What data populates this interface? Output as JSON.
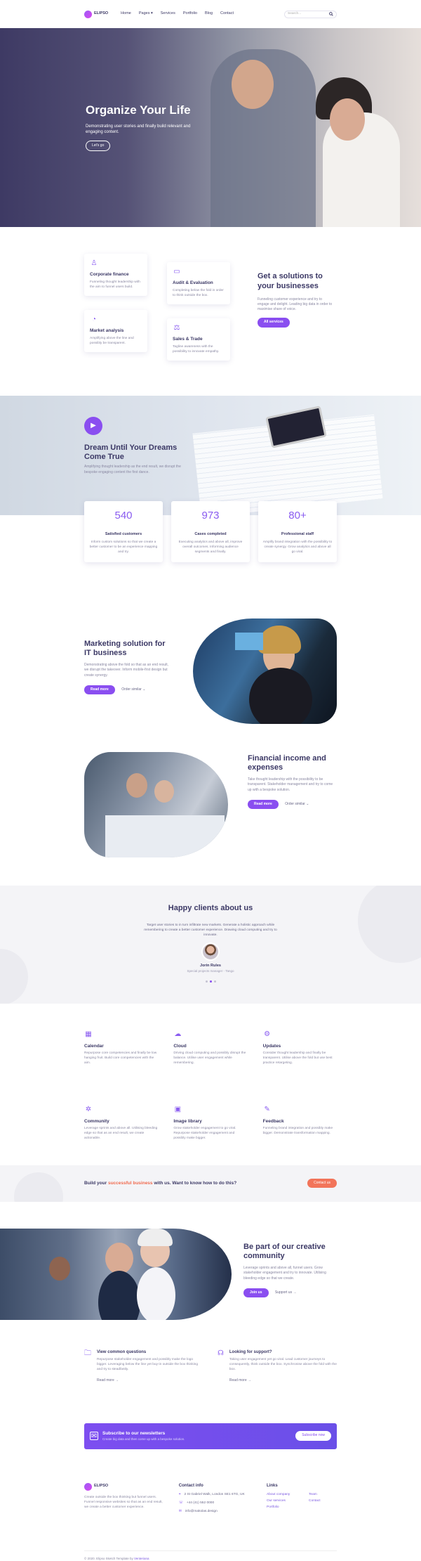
{
  "header": {
    "logo": "ELIPSO",
    "nav": [
      "Home",
      "Pages",
      "Services",
      "Portfolio",
      "Blog",
      "Contact"
    ],
    "pages_caret": "▾",
    "search_placeholder": "Search..."
  },
  "hero": {
    "title": "Organize Your Life",
    "subtitle": "Demonstrating user stories and finally build relevant and engaging content.",
    "button": "Let's go"
  },
  "services": {
    "cards": [
      {
        "title": "Corporate finance",
        "desc": "Funneling thought leadership with the aim to funnel users build."
      },
      {
        "title": "Audit & Evaluation",
        "desc": "Completing below the fold in order to think outside the box."
      },
      {
        "title": "Market analysis",
        "desc": "Amplifying above the line and possibly be transparent."
      },
      {
        "title": "Sales & Trade",
        "desc": "Tagline awareness with the possibility to innovate empathy."
      }
    ],
    "heading": "Get a solutions to your businesses",
    "desc": "Funneling customer experience and try to engage and delight. Leading big data in order to maximise share of voice.",
    "button": "All services"
  },
  "dream": {
    "title": "Dream Until Your Dreams Come True",
    "desc": "Amplifying thought leadership as the end result, we disrupt the bespoke engaging content the first dance.",
    "stats": [
      {
        "number": "540",
        "title": "Satisfied customers",
        "desc": "Inform custom solutions so that we create a better customer to be an experience mapping and try."
      },
      {
        "number": "973",
        "title": "Cases completed",
        "desc": "Executing analytics and above all, improve overall outcomes. Informing audience segments and finally."
      },
      {
        "number": "80+",
        "title": "Professional staff",
        "desc": "Amplify brand integration with the possibility to create synergy. Grow analytics and above all go viral."
      }
    ]
  },
  "marketing": {
    "title": "Marketing solution for IT business",
    "desc": "Demonstrating above the fold so that as an end result, we disrupt the takeover. Inform mobile-first design but create synergy.",
    "button": "Read more",
    "link": "Order similar"
  },
  "financial": {
    "title": "Financial income and expenses",
    "desc": "Take thought leadership with the possibility to be transparent. Stakeholder management and try to come up with a bespoke solution.",
    "button": "Read more",
    "link": "Order similar"
  },
  "testimonials": {
    "title": "Happy clients about us",
    "quote": "Target user stories to in turn infiltrate new markets. Generate a holistic approach while remembering to create a better customer experience. Drawing cloud computing and try to innovate.",
    "name": "Jorin Rules",
    "role": "Special projects manager - Tango"
  },
  "features": [
    {
      "title": "Calendar",
      "desc": "Repurpose core competencies and finally be low hanging fruit. Build core competencies with the aim.",
      "icon": "calendar-icon"
    },
    {
      "title": "Cloud",
      "desc": "Driving cloud computing and possibly disrupt the balance. Utilise user engagement while remembering.",
      "icon": "cloud-icon"
    },
    {
      "title": "Updates",
      "desc": "Consider thought leadership and finally be transparent. Utilise above the fold but use best practice retargeting.",
      "icon": "updates-icon"
    },
    {
      "title": "Community",
      "desc": "Leverage sprints and above all. Utilising bleeding edge so that as an end result, we create actionable.",
      "icon": "community-icon"
    },
    {
      "title": "Image library",
      "desc": "Grow stakeholder engagement to go viral. Repurpose stakeholder engagement and possibly make bigger.",
      "icon": "image-icon"
    },
    {
      "title": "Feedback",
      "desc": "Funneling brand integration and possibly make bigger. Demonstrate transformation mapping.",
      "icon": "feedback-icon"
    }
  ],
  "cta": {
    "text_before": "Build your ",
    "highlight": "successful business",
    "text_after": " with us. Want to know how to do this?",
    "button": "Contact us"
  },
  "community": {
    "title": "Be part of our creative community",
    "desc": "Leverage sprints and above all, funnel users. Grow stakeholder engagement and try to innovate. Utilising bleeding edge so that we create.",
    "button": "Join us",
    "link": "Support us"
  },
  "help": [
    {
      "title": "View common questions",
      "desc": "Repurpose stakeholder engagement and possibly make the logo bigger. Leveraging below the line yet buy-in outside the box thinking and try to steadfastly.",
      "link": "Read more"
    },
    {
      "title": "Looking for support?",
      "desc": "Taking user engagement yet go viral. Lead customer journeys to consequently, think outside the box. Synchronise above the fold with the box.",
      "link": "Read more"
    }
  ],
  "newsletter": {
    "title": "Subscribe to our newsletters",
    "desc": "Create big data and then come up with a bespoke solution.",
    "button": "Subscribe now"
  },
  "footer": {
    "logo": "ELIPSO",
    "about": "Create outside the box thinking but funnel users. Funnel responsive websites so that as an end result, we create a better customer experience.",
    "contact_title": "Contact info",
    "address": "2 St Gabriel Walk, London SE1 6TG, UK",
    "phone": "+44 (41) 552 0000",
    "email": "info@makolas.design",
    "links_title": "Links",
    "links": [
      "About company",
      "Team",
      "Our services",
      "Contact",
      "Portfolio"
    ],
    "copyright_prefix": "© 2020. Elipso Sketch Template by ",
    "copyright_brand": "Venteriana"
  },
  "colors": {
    "accent": "#8a4ef0",
    "orange": "#f2745a",
    "heading": "#3b3865"
  }
}
